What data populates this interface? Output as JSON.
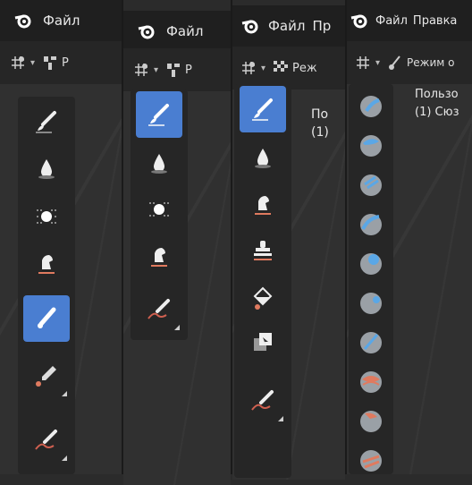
{
  "colors": {
    "active_tool": "#4a7ed1",
    "topbar": "#1f1f1f",
    "toolbar_bg": "#262626",
    "viewport": "#303030"
  },
  "panels": [
    {
      "menu": [
        "Файл"
      ],
      "mode_label": "Р",
      "info": [
        "",
        ""
      ]
    },
    {
      "menu": [
        "Файл"
      ],
      "mode_label": "Р",
      "info": [
        "",
        ""
      ]
    },
    {
      "menu": [
        "Файл",
        "Пр"
      ],
      "mode_label": "Реж",
      "info": [
        "По",
        "(1)"
      ]
    },
    {
      "menu": [
        "Файл",
        "Правка"
      ],
      "mode_label": "Режим о",
      "info": [
        "Пользо",
        "(1) Сюз"
      ]
    }
  ],
  "icons": {
    "logo": "blender-logo-icon",
    "transform": "transform-pivot-icon",
    "brush": "brush-icon",
    "drop": "drop-icon",
    "sun": "light-dots-icon",
    "hand": "smear-hand-icon",
    "stamp": "clone-stamp-icon",
    "bucket": "fill-bucket-icon",
    "mask": "mask-icon",
    "eyedropper": "eyedropper-icon",
    "pencil": "annotate-pencil-icon",
    "sculpt": "sculpt-sphere-icon"
  }
}
